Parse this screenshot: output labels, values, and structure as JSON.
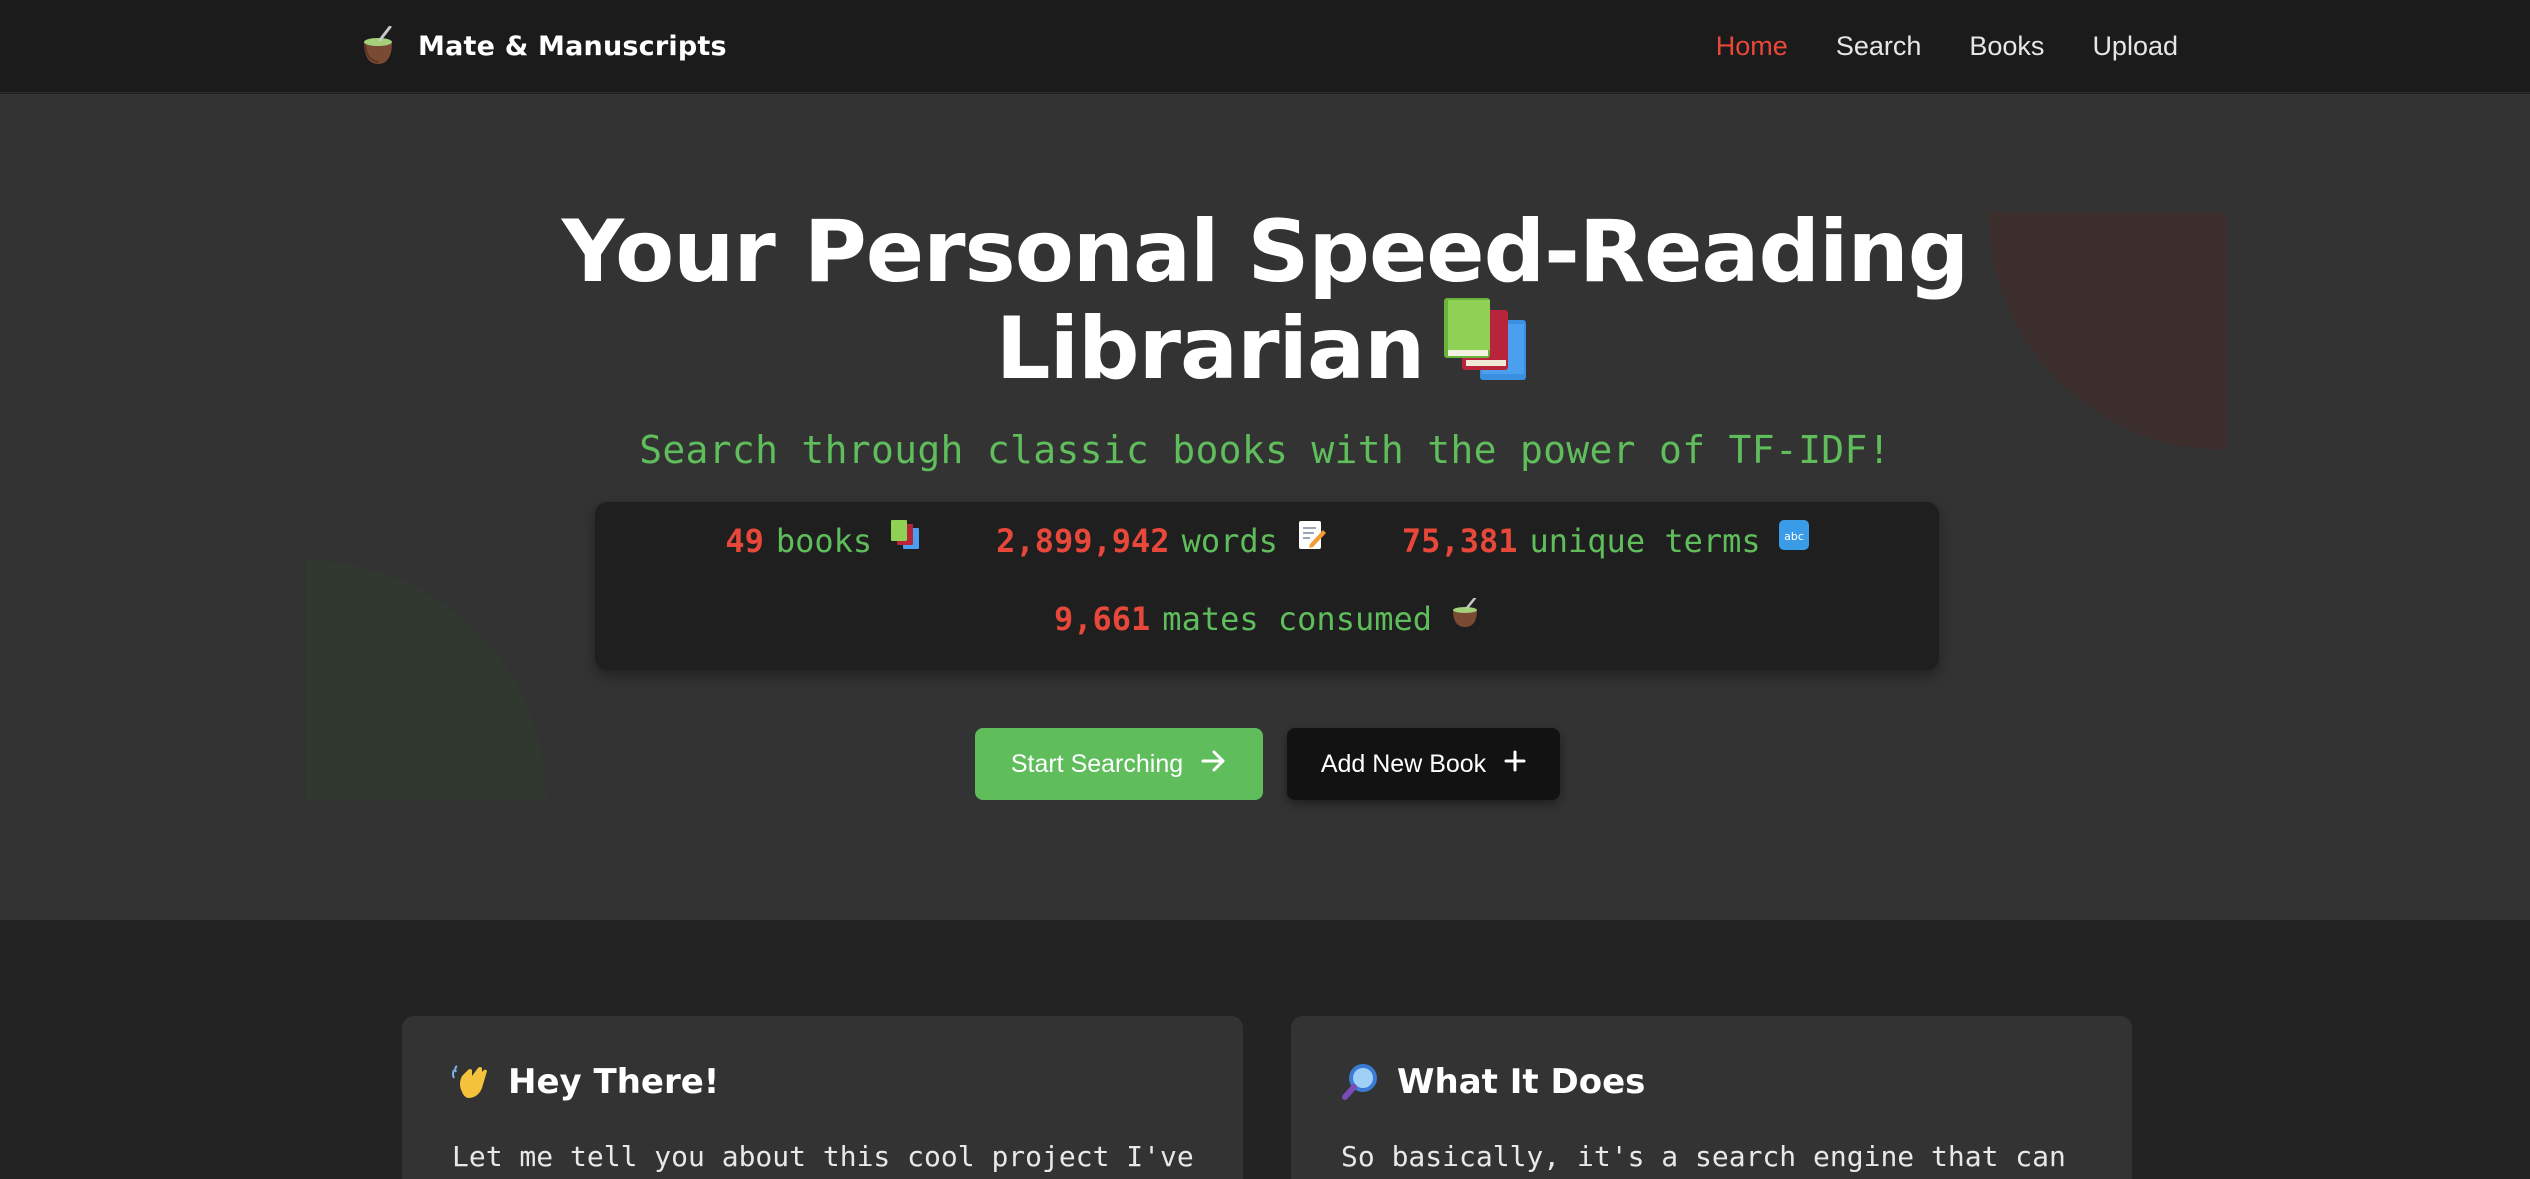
{
  "nav": {
    "brand": "Mate & Manuscripts",
    "brand_icon": "mate-gourd-icon",
    "links": [
      {
        "label": "Home",
        "active": true
      },
      {
        "label": "Search",
        "active": false
      },
      {
        "label": "Books",
        "active": false
      },
      {
        "label": "Upload",
        "active": false
      }
    ]
  },
  "hero": {
    "title_line1": "Your Personal Speed-Reading",
    "title_line2": "Librarian",
    "title_icon": "books-icon",
    "subtitle": "Search through classic books with the power of TF-IDF!",
    "stats": [
      {
        "value": "49",
        "label": "books",
        "icon": "books-icon"
      },
      {
        "value": "2,899,942",
        "label": "words",
        "icon": "memo-icon"
      },
      {
        "value": "75,381",
        "label": "unique terms",
        "icon": "abc-icon"
      },
      {
        "value": "9,661",
        "label": "mates consumed",
        "icon": "mate-gourd-icon"
      }
    ],
    "buttons": {
      "primary": "Start Searching",
      "secondary": "Add New Book"
    }
  },
  "cards": [
    {
      "title": "Hey There!",
      "icon": "waving-hand-icon",
      "text": "Let me tell you about this cool project I've"
    },
    {
      "title": "What It Does",
      "icon": "magnifier-icon",
      "text": "So basically, it's a search engine that can"
    }
  ],
  "colors": {
    "accent_red": "#e8483a",
    "accent_green": "#5fbd5b",
    "nav_bg": "#1b1b1b",
    "hero_bg": "#333333",
    "page_bg": "#232323"
  }
}
